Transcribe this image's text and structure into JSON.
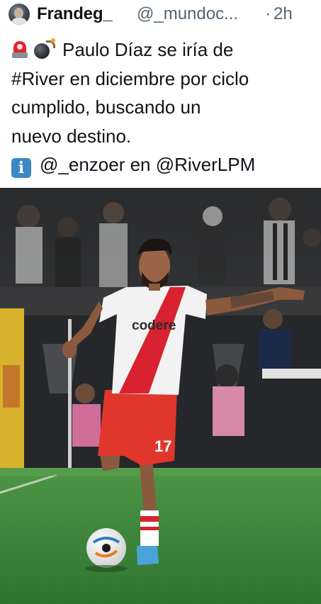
{
  "tweet": {
    "display_name": "Frandeg_",
    "handle": "@_mundoc...",
    "separator": "·",
    "time": "2h",
    "lines": [
      "Paulo Díaz se iría de",
      "#River en diciembre por ciclo",
      "cumplido, buscando un",
      "nuevo destino."
    ],
    "source_prefix": "@_enzoer en ",
    "source_account": "@RiverLPM",
    "emojis": [
      "rotating-light-icon",
      "bomb-icon",
      "info-icon"
    ]
  },
  "photo": {
    "jersey_sponsor": "codere",
    "shorts_number": "17"
  },
  "colors": {
    "text": "#0f1419",
    "muted": "#536471",
    "pitch": "#3f8a3a",
    "river_red": "#d8222f"
  }
}
